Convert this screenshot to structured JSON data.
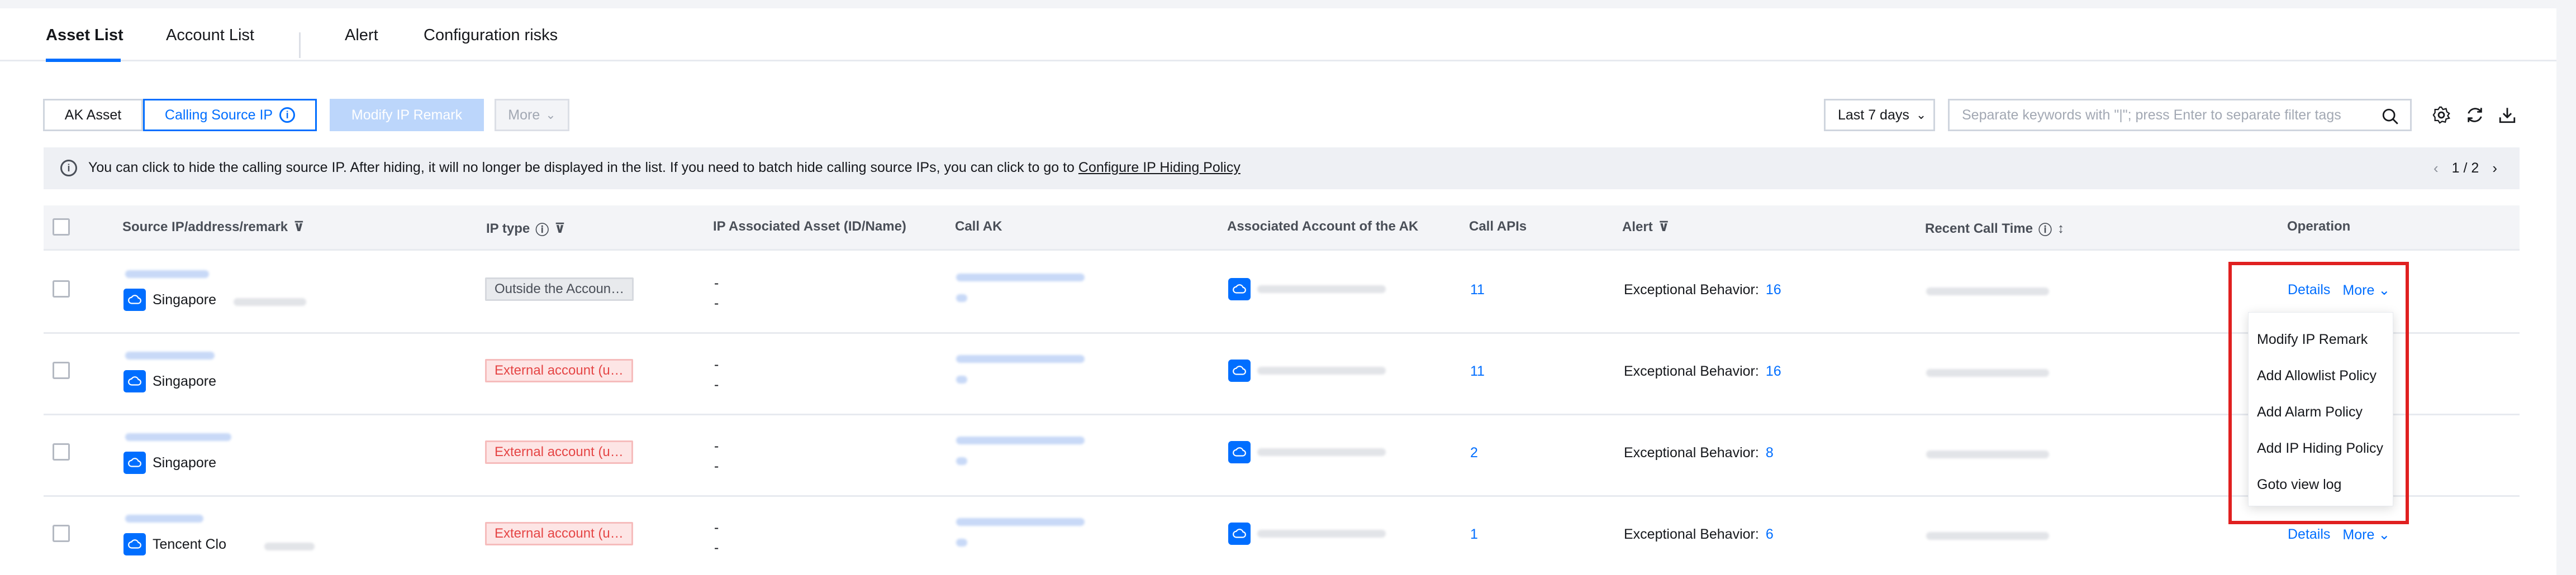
{
  "tabs": [
    {
      "label": "Asset List",
      "active": true
    },
    {
      "label": "Account List"
    },
    {
      "label": "Alert"
    },
    {
      "label": "Configuration risks"
    }
  ],
  "toolbar": {
    "ak_asset": "AK Asset",
    "calling_source_ip": "Calling Source IP",
    "modify_ip_remark": "Modify IP Remark",
    "more": "More",
    "date_range": "Last 7 days",
    "search_placeholder": "Separate keywords with \"|\"; press Enter to separate filter tags"
  },
  "notice": {
    "text": "You can click to hide the calling source IP. After hiding, it will no longer be displayed in the list. If you need to batch hide calling source IPs, you can click to go to",
    "link": "Configure IP Hiding Policy",
    "pager": "1 / 2"
  },
  "columns": {
    "source": "Source IP/address/remark",
    "ip_type": "IP type",
    "associated_asset": "IP Associated Asset (ID/Name)",
    "call_ak": "Call AK",
    "associated_account": "Associated Account of the AK",
    "call_apis": "Call APIs",
    "alert": "Alert",
    "recent_call_time": "Recent Call Time",
    "operation": "Operation"
  },
  "rows": [
    {
      "region": "Singapore",
      "ip_type": "Outside the Accoun…",
      "ip_type_style": "gray",
      "asset1": "-",
      "asset2": "-",
      "call_apis": "11",
      "alert_label": "Exceptional Behavior:",
      "alert_count": "16"
    },
    {
      "region": "Singapore",
      "ip_type": "External account (u…",
      "ip_type_style": "red",
      "asset1": "-",
      "asset2": "-",
      "call_apis": "11",
      "alert_label": "Exceptional Behavior:",
      "alert_count": "16"
    },
    {
      "region": "Singapore",
      "ip_type": "External account (u…",
      "ip_type_style": "red",
      "asset1": "-",
      "asset2": "-",
      "call_apis": "2",
      "alert_label": "Exceptional Behavior:",
      "alert_count": "8"
    },
    {
      "region": "Tencent Clo",
      "ip_type": "External account (u…",
      "ip_type_style": "red",
      "asset1": "-",
      "asset2": "-",
      "call_apis": "1",
      "alert_label": "Exceptional Behavior:",
      "alert_count": "6"
    }
  ],
  "ops": {
    "details": "Details",
    "more": "More"
  },
  "menu": [
    "Modify IP Remark",
    "Add Allowlist Policy",
    "Add Alarm Policy",
    "Add IP Hiding Policy",
    "Goto view log"
  ],
  "colors": {
    "accent": "#006eff",
    "danger": "#e54545",
    "highlight": "#e02020"
  }
}
